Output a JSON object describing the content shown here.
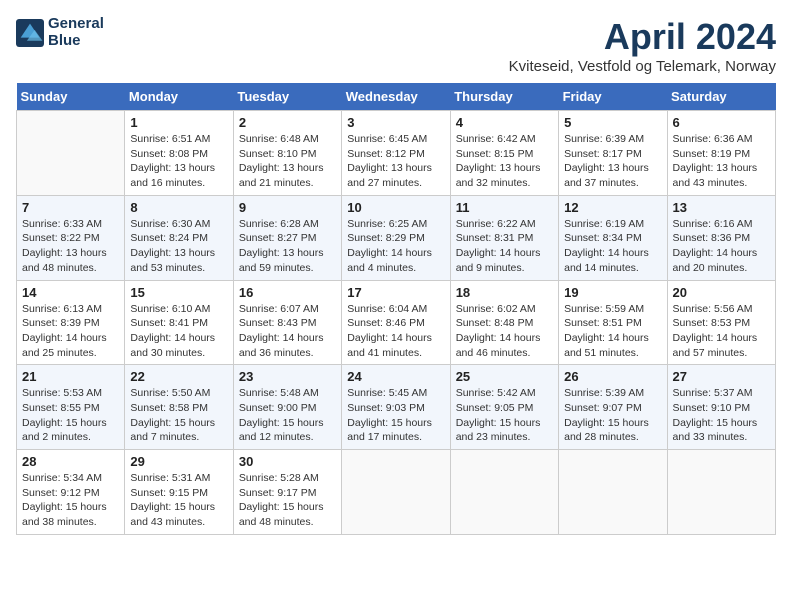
{
  "header": {
    "logo_line1": "General",
    "logo_line2": "Blue",
    "title": "April 2024",
    "subtitle": "Kviteseid, Vestfold og Telemark, Norway"
  },
  "weekdays": [
    "Sunday",
    "Monday",
    "Tuesday",
    "Wednesday",
    "Thursday",
    "Friday",
    "Saturday"
  ],
  "weeks": [
    [
      {
        "day": "",
        "info": ""
      },
      {
        "day": "1",
        "info": "Sunrise: 6:51 AM\nSunset: 8:08 PM\nDaylight: 13 hours\nand 16 minutes."
      },
      {
        "day": "2",
        "info": "Sunrise: 6:48 AM\nSunset: 8:10 PM\nDaylight: 13 hours\nand 21 minutes."
      },
      {
        "day": "3",
        "info": "Sunrise: 6:45 AM\nSunset: 8:12 PM\nDaylight: 13 hours\nand 27 minutes."
      },
      {
        "day": "4",
        "info": "Sunrise: 6:42 AM\nSunset: 8:15 PM\nDaylight: 13 hours\nand 32 minutes."
      },
      {
        "day": "5",
        "info": "Sunrise: 6:39 AM\nSunset: 8:17 PM\nDaylight: 13 hours\nand 37 minutes."
      },
      {
        "day": "6",
        "info": "Sunrise: 6:36 AM\nSunset: 8:19 PM\nDaylight: 13 hours\nand 43 minutes."
      }
    ],
    [
      {
        "day": "7",
        "info": "Sunrise: 6:33 AM\nSunset: 8:22 PM\nDaylight: 13 hours\nand 48 minutes."
      },
      {
        "day": "8",
        "info": "Sunrise: 6:30 AM\nSunset: 8:24 PM\nDaylight: 13 hours\nand 53 minutes."
      },
      {
        "day": "9",
        "info": "Sunrise: 6:28 AM\nSunset: 8:27 PM\nDaylight: 13 hours\nand 59 minutes."
      },
      {
        "day": "10",
        "info": "Sunrise: 6:25 AM\nSunset: 8:29 PM\nDaylight: 14 hours\nand 4 minutes."
      },
      {
        "day": "11",
        "info": "Sunrise: 6:22 AM\nSunset: 8:31 PM\nDaylight: 14 hours\nand 9 minutes."
      },
      {
        "day": "12",
        "info": "Sunrise: 6:19 AM\nSunset: 8:34 PM\nDaylight: 14 hours\nand 14 minutes."
      },
      {
        "day": "13",
        "info": "Sunrise: 6:16 AM\nSunset: 8:36 PM\nDaylight: 14 hours\nand 20 minutes."
      }
    ],
    [
      {
        "day": "14",
        "info": "Sunrise: 6:13 AM\nSunset: 8:39 PM\nDaylight: 14 hours\nand 25 minutes."
      },
      {
        "day": "15",
        "info": "Sunrise: 6:10 AM\nSunset: 8:41 PM\nDaylight: 14 hours\nand 30 minutes."
      },
      {
        "day": "16",
        "info": "Sunrise: 6:07 AM\nSunset: 8:43 PM\nDaylight: 14 hours\nand 36 minutes."
      },
      {
        "day": "17",
        "info": "Sunrise: 6:04 AM\nSunset: 8:46 PM\nDaylight: 14 hours\nand 41 minutes."
      },
      {
        "day": "18",
        "info": "Sunrise: 6:02 AM\nSunset: 8:48 PM\nDaylight: 14 hours\nand 46 minutes."
      },
      {
        "day": "19",
        "info": "Sunrise: 5:59 AM\nSunset: 8:51 PM\nDaylight: 14 hours\nand 51 minutes."
      },
      {
        "day": "20",
        "info": "Sunrise: 5:56 AM\nSunset: 8:53 PM\nDaylight: 14 hours\nand 57 minutes."
      }
    ],
    [
      {
        "day": "21",
        "info": "Sunrise: 5:53 AM\nSunset: 8:55 PM\nDaylight: 15 hours\nand 2 minutes."
      },
      {
        "day": "22",
        "info": "Sunrise: 5:50 AM\nSunset: 8:58 PM\nDaylight: 15 hours\nand 7 minutes."
      },
      {
        "day": "23",
        "info": "Sunrise: 5:48 AM\nSunset: 9:00 PM\nDaylight: 15 hours\nand 12 minutes."
      },
      {
        "day": "24",
        "info": "Sunrise: 5:45 AM\nSunset: 9:03 PM\nDaylight: 15 hours\nand 17 minutes."
      },
      {
        "day": "25",
        "info": "Sunrise: 5:42 AM\nSunset: 9:05 PM\nDaylight: 15 hours\nand 23 minutes."
      },
      {
        "day": "26",
        "info": "Sunrise: 5:39 AM\nSunset: 9:07 PM\nDaylight: 15 hours\nand 28 minutes."
      },
      {
        "day": "27",
        "info": "Sunrise: 5:37 AM\nSunset: 9:10 PM\nDaylight: 15 hours\nand 33 minutes."
      }
    ],
    [
      {
        "day": "28",
        "info": "Sunrise: 5:34 AM\nSunset: 9:12 PM\nDaylight: 15 hours\nand 38 minutes."
      },
      {
        "day": "29",
        "info": "Sunrise: 5:31 AM\nSunset: 9:15 PM\nDaylight: 15 hours\nand 43 minutes."
      },
      {
        "day": "30",
        "info": "Sunrise: 5:28 AM\nSunset: 9:17 PM\nDaylight: 15 hours\nand 48 minutes."
      },
      {
        "day": "",
        "info": ""
      },
      {
        "day": "",
        "info": ""
      },
      {
        "day": "",
        "info": ""
      },
      {
        "day": "",
        "info": ""
      }
    ]
  ]
}
